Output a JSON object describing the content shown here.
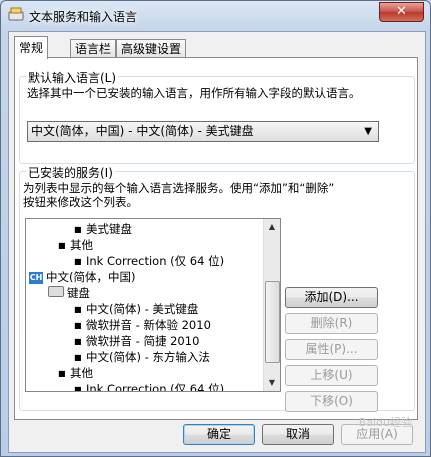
{
  "window": {
    "title": "文本服务和输入语言",
    "close_label": "✕"
  },
  "tabs": [
    "常规",
    "语言栏",
    "高级键设置"
  ],
  "default_lang": {
    "title": "默认输入语言(L)",
    "desc": "选择其中一个已安装的输入语言，用作所有输入字段的默认语言。",
    "selected": "中文(简体，中国) - 中文(简体) - 美式键盘"
  },
  "installed": {
    "title": "已安装的服务(I)",
    "desc_line1": "为列表中显示的每个输入语言选择服务。使用“添加”和“删除”",
    "desc_line2": "按钮来修改这个列表。",
    "tree": [
      "美式键盘",
      "其他",
      "Ink Correction (仅 64 位)",
      "中文(简体，中国)",
      "键盘",
      "中文(简体) - 美式键盘",
      "微软拼音 - 新体验 2010",
      "微软拼音 - 简捷 2010",
      "中文(简体) - 东方输入法",
      "其他",
      "Ink Correction (仅 64 位)"
    ],
    "ch_badge": "CH",
    "buttons": {
      "add": "添加(D)...",
      "remove": "删除(R)",
      "properties": "属性(P)...",
      "move_up": "上移(U)",
      "move_down": "下移(O)"
    }
  },
  "footer": {
    "ok": "确定",
    "cancel": "取消",
    "apply": "应用(A)"
  },
  "watermark": "Baidu经验"
}
